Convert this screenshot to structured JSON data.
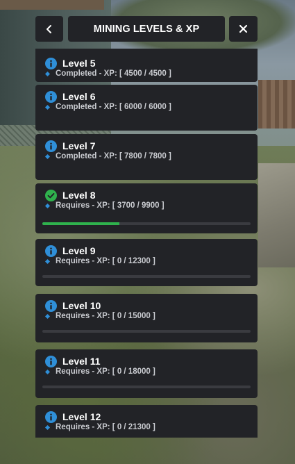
{
  "header": {
    "title": "MINING LEVELS & XP",
    "back_icon": "chevron-left-icon",
    "close_icon": "close-icon"
  },
  "colors": {
    "panel": "#222327",
    "info_icon": "#2f8fd8",
    "check_icon": "#2fb24d",
    "progress_fill": "#2fb24d",
    "progress_track": "#3a3b40"
  },
  "levels": [
    {
      "title": "Level 5",
      "status": "Completed - XP: [ 4500 / 4500 ]",
      "icon": "info-icon",
      "completed": true
    },
    {
      "title": "Level 6",
      "status": "Completed - XP: [ 6000 / 6000 ]",
      "icon": "info-icon",
      "completed": true
    },
    {
      "title": "Level 7",
      "status": "Completed - XP: [ 7800 / 7800 ]",
      "icon": "info-icon",
      "completed": true
    },
    {
      "title": "Level 8",
      "status": "Requires - XP: [ 3700 / 9900 ]",
      "icon": "check-circle-icon",
      "completed": false,
      "progress": 0.37
    },
    {
      "title": "Level 9",
      "status": "Requires - XP: [ 0 / 12300 ]",
      "icon": "info-icon",
      "completed": false,
      "progress": 0
    },
    {
      "title": "Level 10",
      "status": "Requires - XP: [ 0 / 15000 ]",
      "icon": "info-icon",
      "completed": false,
      "progress": 0
    },
    {
      "title": "Level 11",
      "status": "Requires - XP: [ 0 / 18000 ]",
      "icon": "info-icon",
      "completed": false,
      "progress": 0
    },
    {
      "title": "Level 12",
      "status": "Requires - XP: [ 0 / 21300 ]",
      "icon": "info-icon",
      "completed": false,
      "progress": 0
    }
  ]
}
